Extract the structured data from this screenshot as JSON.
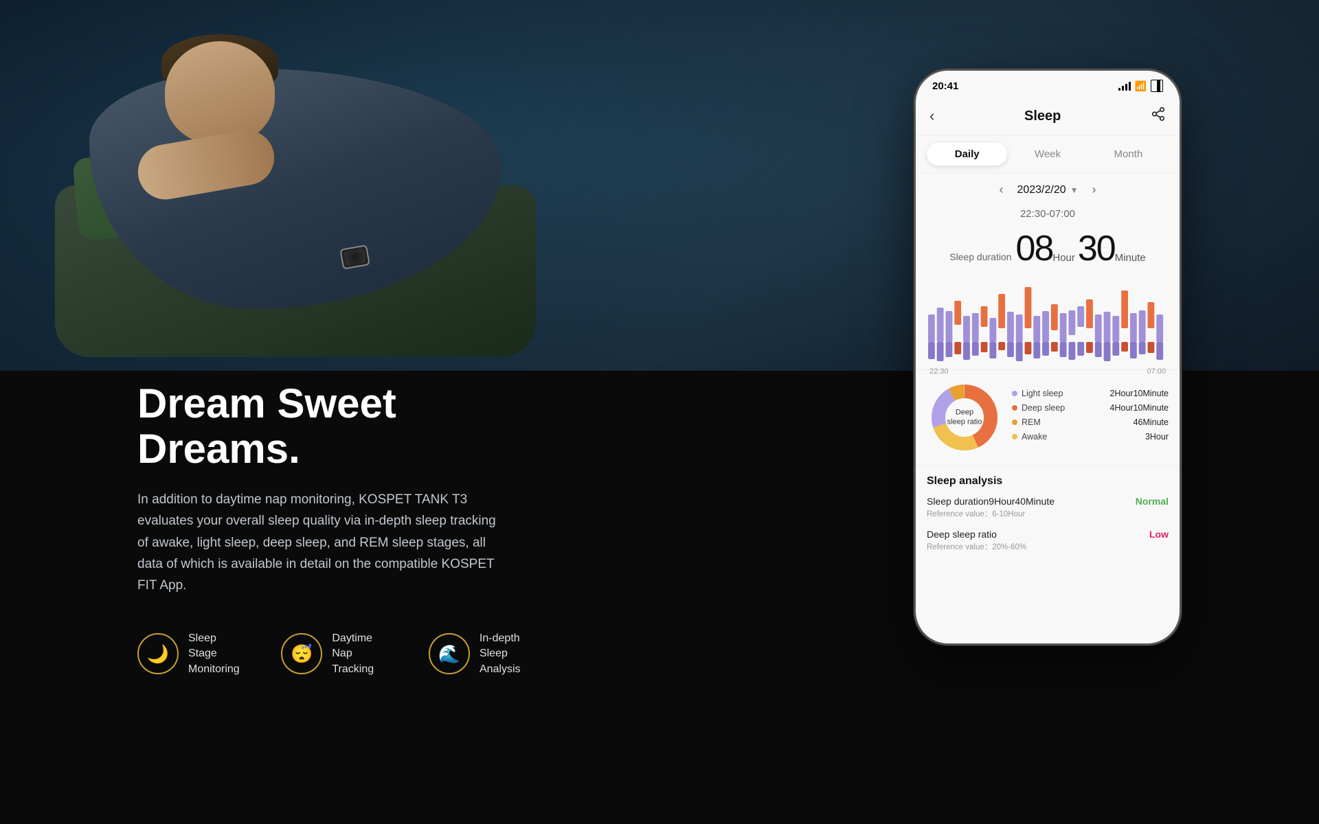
{
  "background": {
    "photo_area_height": 540,
    "bottom_bg": "#0a0a0a"
  },
  "left_content": {
    "tagline": "Dream Sweet Dreams.",
    "description": "In addition to daytime nap monitoring, KOSPET TANK T3 evaluates your overall sleep quality via in-depth sleep tracking of awake, light sleep, deep sleep, and REM sleep stages, all data of which is available in detail on the compatible KOSPET FIT App.",
    "features": [
      {
        "id": "sleep-stage",
        "icon": "🌙",
        "label": "Sleep Stage\nMonitoring"
      },
      {
        "id": "daytime-nap",
        "icon": "😴",
        "label": "Daytime Nap\nTracking"
      },
      {
        "id": "in-depth",
        "icon": "🌊",
        "label": "In-depth Sleep\nAnalysis"
      }
    ]
  },
  "nap_tracking": {
    "label": "Daytime Nap Tracking"
  },
  "phone": {
    "status_bar": {
      "time": "20:41",
      "signal": "●●●",
      "wifi": "WiFi",
      "battery": "Battery"
    },
    "header": {
      "back_icon": "‹",
      "title": "Sleep",
      "share_icon": "⚙"
    },
    "tabs": [
      {
        "id": "daily",
        "label": "Daily",
        "active": true
      },
      {
        "id": "week",
        "label": "Week",
        "active": false
      },
      {
        "id": "month",
        "label": "Month",
        "active": false
      }
    ],
    "date_nav": {
      "prev_icon": "‹",
      "date": "2023/2/20",
      "dropdown_icon": "▼",
      "next_icon": "›"
    },
    "sleep_time_range": "22:30-07:00",
    "sleep_duration": {
      "label": "Sleep duration",
      "hours": "08",
      "hour_unit": "Hour",
      "minutes": "30",
      "minute_unit": "Minute"
    },
    "chart": {
      "time_start": "22:30",
      "time_end": "07:00",
      "bars": [
        {
          "type": "purple",
          "h1": 40,
          "h2": 30
        },
        {
          "type": "purple",
          "h1": 50,
          "h2": 35
        },
        {
          "type": "purple",
          "h1": 45,
          "h2": 28
        },
        {
          "type": "orange",
          "h1": 55,
          "h2": 20
        },
        {
          "type": "purple",
          "h1": 38,
          "h2": 32
        },
        {
          "type": "purple",
          "h1": 42,
          "h2": 25
        },
        {
          "type": "orange",
          "h1": 48,
          "h2": 18
        },
        {
          "type": "purple",
          "h1": 35,
          "h2": 30
        },
        {
          "type": "orange",
          "h1": 60,
          "h2": 15
        },
        {
          "type": "purple",
          "h1": 44,
          "h2": 28
        },
        {
          "type": "purple",
          "h1": 40,
          "h2": 35
        },
        {
          "type": "orange",
          "h1": 70,
          "h2": 22
        },
        {
          "type": "purple",
          "h1": 38,
          "h2": 30
        },
        {
          "type": "purple",
          "h1": 45,
          "h2": 26
        },
        {
          "type": "orange",
          "h1": 52,
          "h2": 18
        },
        {
          "type": "purple",
          "h1": 42,
          "h2": 28
        }
      ]
    },
    "donut": {
      "center_line1": "Deep",
      "center_line2": "sleep ratio",
      "segments": [
        {
          "label": "Light sleep",
          "color": "#b0a0e8",
          "value": "2Hour10Minute",
          "percent": 22
        },
        {
          "label": "Deep sleep",
          "color": "#e87040",
          "value": "4Hour10Minute",
          "percent": 43
        },
        {
          "label": "REM",
          "color": "#e8a030",
          "value": "46Minute",
          "percent": 8
        },
        {
          "label": "Awake",
          "color": "#f0c050",
          "value": "3Hour",
          "percent": 27
        }
      ]
    },
    "analysis": {
      "title": "Sleep analysis",
      "items": [
        {
          "id": "sleep-duration",
          "label": "Sleep duration9Hour40Minute",
          "ref": "Reference value：6-10Hour",
          "status": "Normal",
          "status_type": "normal"
        },
        {
          "id": "deep-sleep-ratio",
          "label": "Deep sleep ratio",
          "ref": "Reference value：20%-60%",
          "status": "Low",
          "status_type": "low"
        }
      ]
    }
  }
}
